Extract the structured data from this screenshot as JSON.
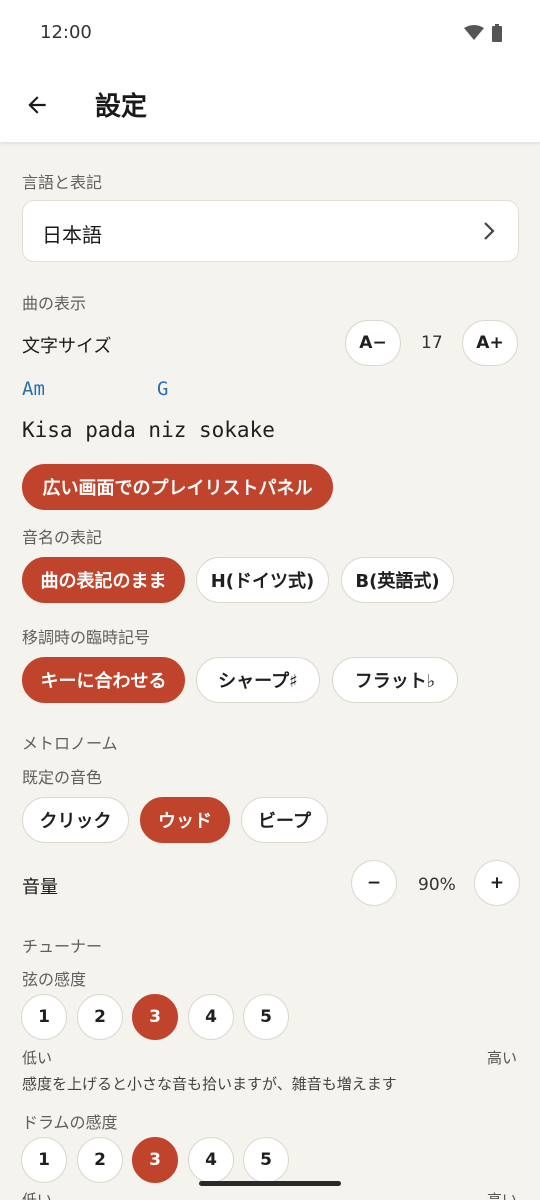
{
  "status": {
    "time": "12:00",
    "wifi_icon": "wifi-icon",
    "battery_icon": "battery-icon"
  },
  "app_bar": {
    "back_icon": "arrow-back-icon",
    "title": "設定"
  },
  "language": {
    "section_label": "言語と表記",
    "value": "日本語"
  },
  "display": {
    "section_label": "曲の表示",
    "font_size_label": "文字サイズ",
    "decrease_label": "A−",
    "font_size_value": "17",
    "increase_label": "A+",
    "preview_chords": [
      "Am",
      "G"
    ],
    "preview_lyric": "Kisa pada niz sokake",
    "playlist_panel_label": "広い画面でのプレイリストパネル"
  },
  "note_names": {
    "section_label": "音名の表記",
    "options": [
      "曲の表記のまま",
      "H(ドイツ式)",
      "B(英語式)"
    ],
    "selected_index": 0
  },
  "accidentals": {
    "section_label": "移調時の臨時記号",
    "options": [
      "キーに合わせる",
      "シャープ♯",
      "フラット♭"
    ],
    "selected_index": 0
  },
  "metronome": {
    "section_label": "メトロノーム",
    "sound_label": "既定の音色",
    "sound_options": [
      "クリック",
      "ウッド",
      "ビープ"
    ],
    "selected_index": 1,
    "volume_label": "音量",
    "volume_minus": "−",
    "volume_value": "90%",
    "volume_plus": "+"
  },
  "tuner": {
    "section_label": "チューナー",
    "string_label": "弦の感度",
    "string_levels": [
      "1",
      "2",
      "3",
      "4",
      "5"
    ],
    "string_selected": 2,
    "low_label": "低い",
    "high_label": "高い",
    "hint": "感度を上げると小さな音も拾いますが、雑音も増えます",
    "drum_label": "ドラムの感度",
    "drum_levels": [
      "1",
      "2",
      "3",
      "4",
      "5"
    ],
    "drum_selected": 2
  },
  "colors": {
    "accent": "#c0442c",
    "chord": "#2a6fae",
    "background": "#f5f3ee"
  }
}
